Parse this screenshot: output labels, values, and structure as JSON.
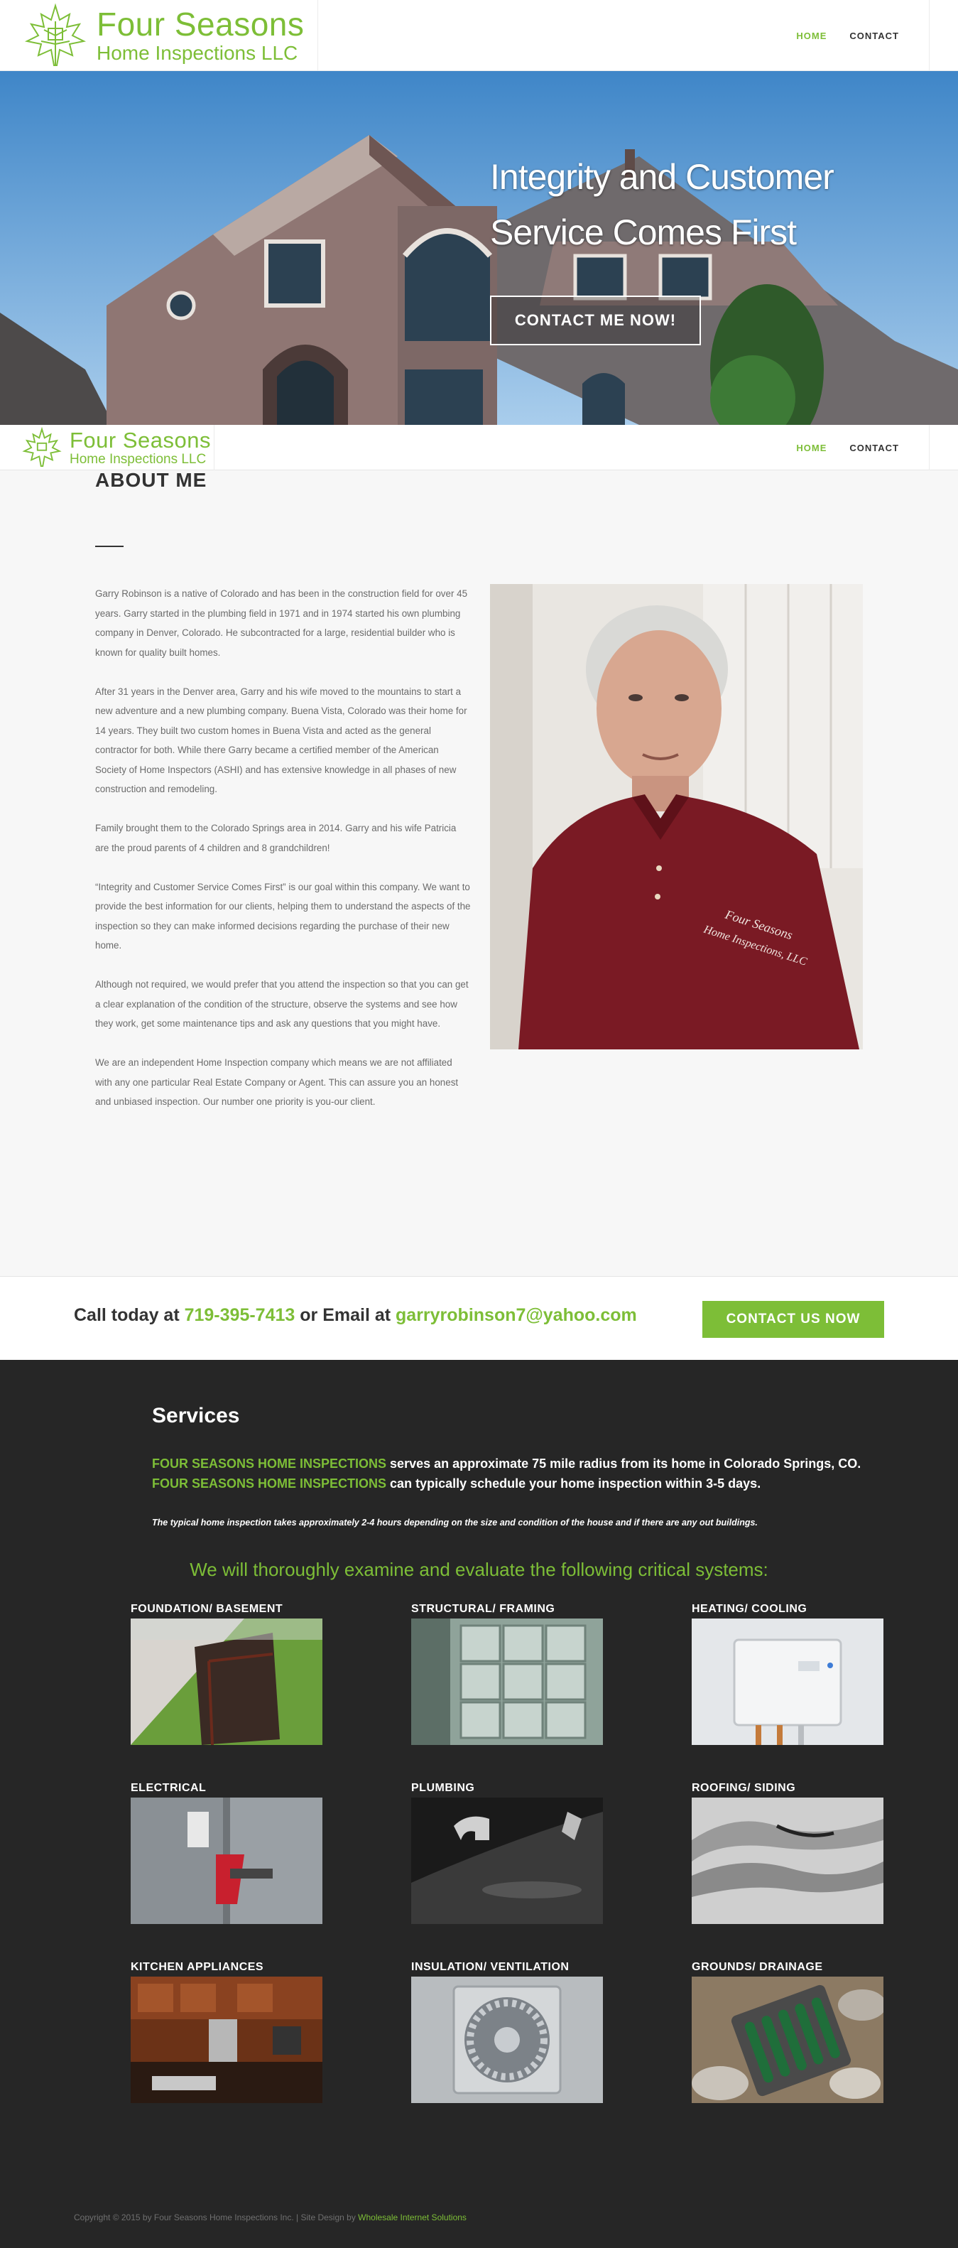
{
  "header": {
    "logo_line1": "Four Seasons",
    "logo_line2": "Home Inspections LLC",
    "nav": [
      {
        "label": "HOME",
        "active": true
      },
      {
        "label": "CONTACT",
        "active": false
      }
    ]
  },
  "hero": {
    "headline_line1": "Integrity and Customer",
    "headline_line2": "Service Comes First",
    "button_label": "CONTACT ME NOW!"
  },
  "about": {
    "title": "ABOUT ME",
    "paragraphs": [
      "Garry Robinson is a native of Colorado and has been in the construction field for over 45 years. Garry started in the plumbing field in 1971 and in 1974 started his own plumbing company in Denver, Colorado. He subcontracted for a large, residential builder who is known for quality built homes.",
      "After 31 years in the Denver area, Garry and his wife moved to the mountains to start a new adventure and a new plumbing company. Buena Vista, Colorado was their home for 14 years. They built two custom homes in Buena Vista and acted as the general contractor for both. While there Garry became a certified member of the American Society of Home Inspectors (ASHI) and has extensive knowledge in all phases of new construction and remodeling.",
      "Family brought them to the Colorado Springs area in 2014. Garry and his wife Patricia are the proud parents of 4 children and 8 grandchildren!",
      "“Integrity and Customer Service Comes First” is our goal within this company. We want to provide the best information for our clients, helping them to understand the aspects of the inspection so they can make informed decisions regarding the purchase of their new home.",
      "Although not required, we would prefer that you attend the inspection so that you can get a clear explanation of the condition of the structure, observe the systems and see how they work, get some maintenance tips and ask any questions that you might have.",
      "We are an independent Home Inspection company which means we are not affiliated with any one particular Real Estate Company or Agent. This can assure you an honest and unbiased inspection. Our number one priority is you-our client."
    ],
    "photo_shirt_text_1": "Four Seasons",
    "photo_shirt_text_2": "Home Inspections, LLC"
  },
  "call": {
    "prefix": "Call today at ",
    "phone": "719-395-7413",
    "middle": " or Email at ",
    "email": "garryrobinson7@yahoo.com",
    "button_label": "CONTACT US NOW"
  },
  "services": {
    "title": "Services",
    "line1_highlight": "FOUR SEASONS HOME INSPECTIONS",
    "line1_rest": " serves an approximate 75 mile radius from its home in Colorado Springs, CO.",
    "line2_highlight": "FOUR SEASONS HOME INSPECTIONS",
    "line2_rest": " can typically schedule your home inspection within 3-5 days.",
    "note": "The typical home inspection takes approximately 2-4 hours depending on the size and condition of the house and if there are any out buildings.",
    "heading": "We will thoroughly examine and evaluate the following critical systems:",
    "items": [
      {
        "label": "FOUNDATION/ BASEMENT",
        "icon": "foundation-photo"
      },
      {
        "label": "STRUCTURAL/ FRAMING",
        "icon": "framing-photo"
      },
      {
        "label": "HEATING/ COOLING",
        "icon": "water-heater-photo"
      },
      {
        "label": "ELECTRICAL",
        "icon": "electrical-panel-photo"
      },
      {
        "label": "PLUMBING",
        "icon": "faucet-photo"
      },
      {
        "label": "ROOFING/ SIDING",
        "icon": "roofing-photo"
      },
      {
        "label": "KITCHEN APPLIANCES",
        "icon": "kitchen-photo"
      },
      {
        "label": "INSULATION/ VENTILATION",
        "icon": "vent-photo"
      },
      {
        "label": "GROUNDS/ DRAINAGE",
        "icon": "drain-photo"
      }
    ]
  },
  "footer": {
    "copyright": "Copyright © 2015 by Four Seasons Home Inspections Inc. | Site Design by ",
    "designer": "Wholesale Internet Solutions"
  },
  "colors": {
    "accent": "#7dbe37",
    "dark": "#262626"
  }
}
